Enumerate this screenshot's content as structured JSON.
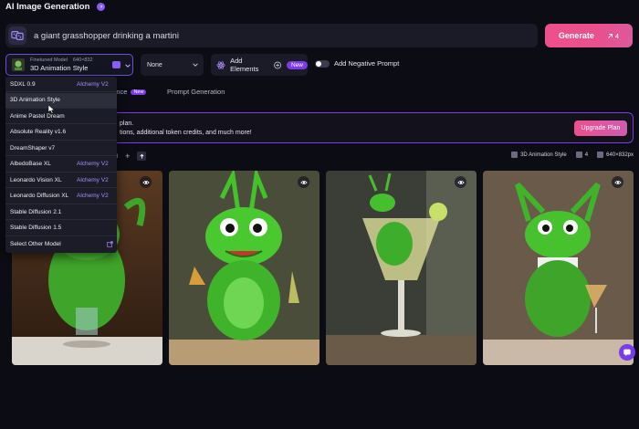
{
  "app": {
    "title": "AI Image Generation"
  },
  "prompt": {
    "value": "a giant grasshopper drinking a martini"
  },
  "generate": {
    "label": "Generate",
    "count": "4"
  },
  "model": {
    "tag": "Finetuned Model",
    "size": "640×832",
    "name": "3D Animation Style"
  },
  "style": {
    "value": "None"
  },
  "elements": {
    "label": "Add Elements",
    "badge": "New"
  },
  "negative": {
    "label": "Add Negative Prompt"
  },
  "tabs": {
    "guidance": "dance",
    "guidance_badge": "New",
    "prompt_gen": "Prompt Generation"
  },
  "banner": {
    "line1": "plan.",
    "line2": "tions, additional token credits, and much more!",
    "button": "Upgrade Plan"
  },
  "gallery": {
    "left_label": "al",
    "model": "3D Animation Style",
    "count": "4",
    "size": "640×832px"
  },
  "dropdown": [
    {
      "label": "SDXL 0.9",
      "tag": "Alchemy V2"
    },
    {
      "label": "3D Animation Style",
      "tag": ""
    },
    {
      "label": "Anime Pastel Dream",
      "tag": ""
    },
    {
      "label": "Absolute Reality v1.6",
      "tag": ""
    },
    {
      "label": "DreamShaper v7",
      "tag": ""
    },
    {
      "label": "AlbedoBase XL",
      "tag": "Alchemy V2"
    },
    {
      "label": "Leonardo Vision XL",
      "tag": "Alchemy V2"
    },
    {
      "label": "Leonardo Diffusion XL",
      "tag": "Alchemy V2"
    },
    {
      "label": "Stable Diffusion 2.1",
      "tag": ""
    },
    {
      "label": "Stable Diffusion 1.5",
      "tag": ""
    },
    {
      "label": "Select Other Model",
      "tag": ""
    }
  ],
  "colors": {
    "accent": "#7c3aed",
    "generate": "#ec4f8e",
    "background": "#0c0d14"
  }
}
